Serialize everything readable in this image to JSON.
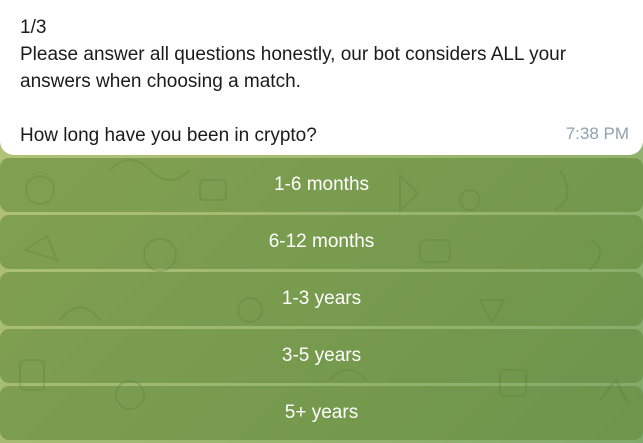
{
  "message": {
    "counter": "1/3",
    "line1": "Please answer all questions honestly, our bot considers ALL your",
    "line2": "answers when choosing a match.",
    "question": "How long have you been in crypto?",
    "time": "7:38 PM"
  },
  "keyboard": {
    "buttons": [
      {
        "label": "1-6 months"
      },
      {
        "label": "6-12 months"
      },
      {
        "label": "1-3 years"
      },
      {
        "label": "3-5 years"
      },
      {
        "label": "5+ years"
      }
    ]
  },
  "colors": {
    "bubble": "#ffffff",
    "time_text": "#8ea2ad",
    "button_bg": "#6f9347",
    "background_light": "#b9c57a",
    "background_dark": "#7fa96a"
  }
}
